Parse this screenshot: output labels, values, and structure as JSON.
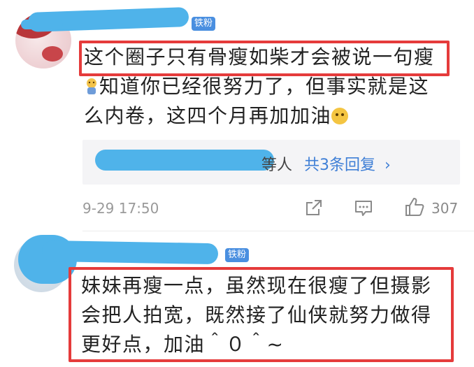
{
  "comment1": {
    "badge": "铁粉",
    "line1": "这个圈子只有骨瘦如柴才会被说一句瘦",
    "line2": "知道你已经很努力了，但事实就是这",
    "line3": "么内卷，这四个月再加加油",
    "emoji_before": "sweat-emoji",
    "emoji_after": "pleading-emoji",
    "reply_suffix": "等人",
    "reply_link": "共3条回复",
    "reply_chevron": "›",
    "timestamp": "9-29 17:50",
    "likes": "307"
  },
  "comment2": {
    "badge": "铁粉",
    "line1": "妹妹再瘦一点，虽然现在很瘦了但摄影",
    "line2": "会把人拍宽，既然接了仙侠就努力做得",
    "line3": "更好点，加油＾０＾~"
  },
  "colors": {
    "highlight_border": "#e53b3b",
    "badge_bg": "#4a8fe0",
    "link": "#3f7fd6",
    "redaction": "#4fb3ea"
  },
  "icons": [
    "share-icon",
    "comment-icon",
    "like-icon",
    "chevron-right-icon"
  ]
}
